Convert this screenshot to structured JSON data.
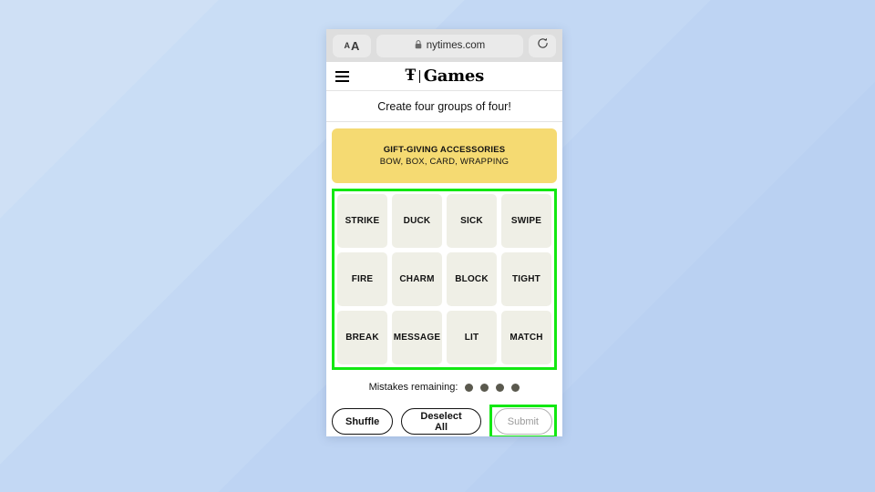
{
  "browser": {
    "text_size_small": "A",
    "text_size_large": "A",
    "lock_icon": "lock-icon",
    "url": "nytimes.com",
    "reload_icon": "reload-icon"
  },
  "site_header": {
    "menu_icon": "hamburger-menu-icon",
    "logo_t": "Ŧ",
    "logo_text": "Games"
  },
  "game": {
    "instruction": "Create four groups of four!",
    "solved_categories": [
      {
        "title": "GIFT-GIVING ACCESSORIES",
        "words": "BOW, BOX, CARD, WRAPPING",
        "color": "#f5da72"
      }
    ],
    "tiles": [
      {
        "label": "STRIKE"
      },
      {
        "label": "DUCK"
      },
      {
        "label": "SICK"
      },
      {
        "label": "SWIPE"
      },
      {
        "label": "FIRE"
      },
      {
        "label": "CHARM"
      },
      {
        "label": "BLOCK"
      },
      {
        "label": "TIGHT"
      },
      {
        "label": "BREAK"
      },
      {
        "label": "MESSAGE"
      },
      {
        "label": "LIT"
      },
      {
        "label": "MATCH"
      }
    ],
    "mistakes": {
      "label": "Mistakes remaining:",
      "remaining": 4,
      "dot_color": "#5a594e"
    },
    "controls": {
      "shuffle": "Shuffle",
      "deselect_all": "Deselect All",
      "submit": "Submit",
      "submit_disabled": true
    }
  },
  "annotations": {
    "highlight_color": "#12e812",
    "targets": [
      "word-grid",
      "submit-button"
    ]
  }
}
